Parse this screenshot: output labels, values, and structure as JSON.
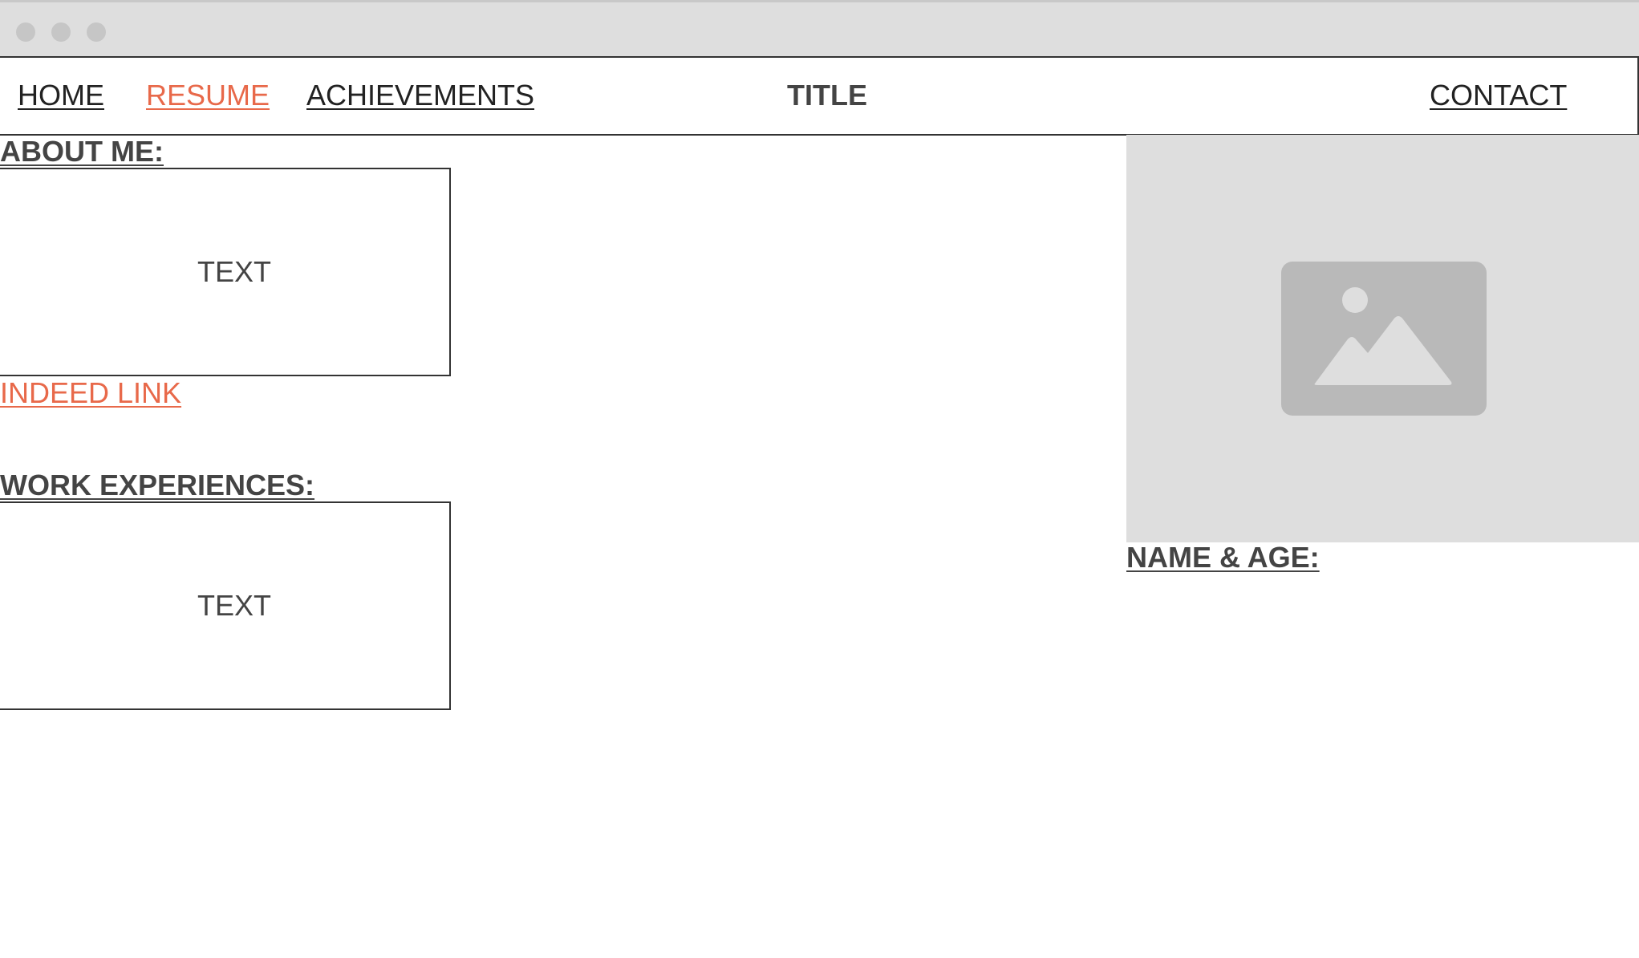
{
  "nav": {
    "home": "HOME",
    "resume": "RESUME",
    "achievements": "ACHIEVEMENTS",
    "title": "TITLE",
    "contact": "CONTACT"
  },
  "about": {
    "heading": "ABOUT ME:",
    "text": "TEXT",
    "indeed_link": "INDEED LINK"
  },
  "work": {
    "heading": "WORK EXPERIENCES:",
    "text": "TEXT"
  },
  "profile": {
    "image_icon": "image-placeholder-icon",
    "name_age_heading": "NAME & AGE:"
  },
  "colors": {
    "accent": "#e8694a",
    "text": "#444444",
    "placeholder_bg": "#dedede"
  }
}
